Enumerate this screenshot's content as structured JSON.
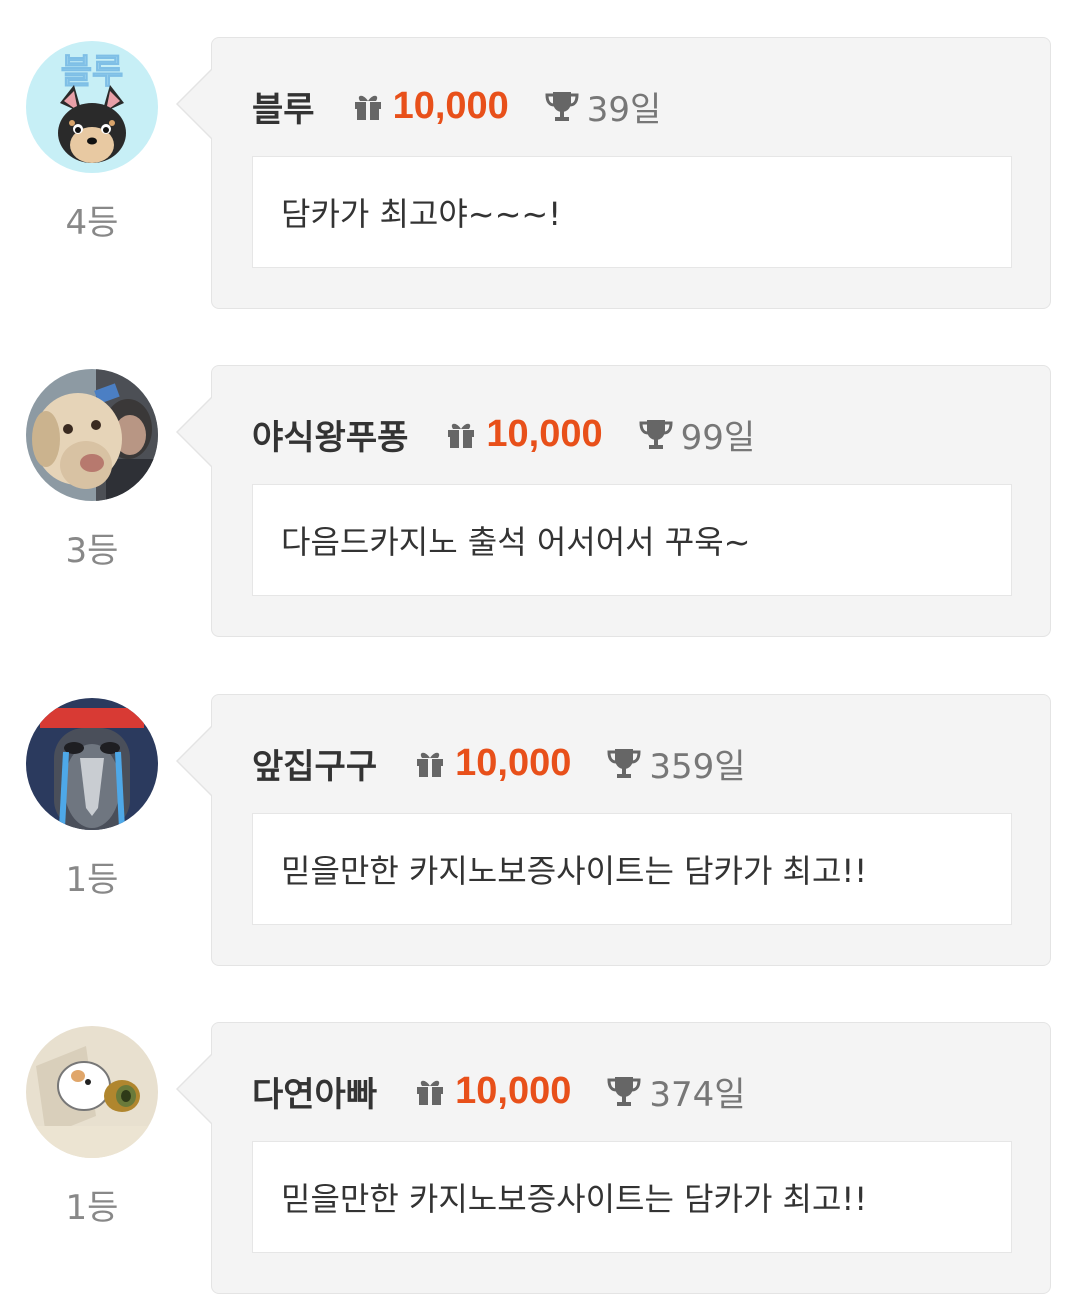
{
  "comments": [
    {
      "rank": "4등",
      "nickname": "블루",
      "points": "10,000",
      "days": "39일",
      "message": "담카가 최고야~~~!",
      "avatar": "chihuahua-avatar"
    },
    {
      "rank": "3등",
      "nickname": "야식왕푸퐁",
      "points": "10,000",
      "days": "99일",
      "message": "다음드카지노 출석 어서어서 꾸욱~",
      "avatar": "dog-photo-avatar"
    },
    {
      "rank": "1등",
      "nickname": "앞집구구",
      "points": "10,000",
      "days": "359일",
      "message": "믿을만한 카지노보증사이트는 담카가 최고!!",
      "avatar": "crying-penguin-avatar"
    },
    {
      "rank": "1등",
      "nickname": "다연아빠",
      "points": "10,000",
      "days": "374일",
      "message": "믿을만한 카지노보증사이트는 담카가 최고!!",
      "avatar": "hamster-avatar"
    }
  ],
  "colors": {
    "points": "#e8501a",
    "card_bg": "#f4f4f4",
    "rank_text": "#888888"
  },
  "icons": {
    "points_icon": "gift-icon",
    "days_icon": "trophy-icon"
  }
}
